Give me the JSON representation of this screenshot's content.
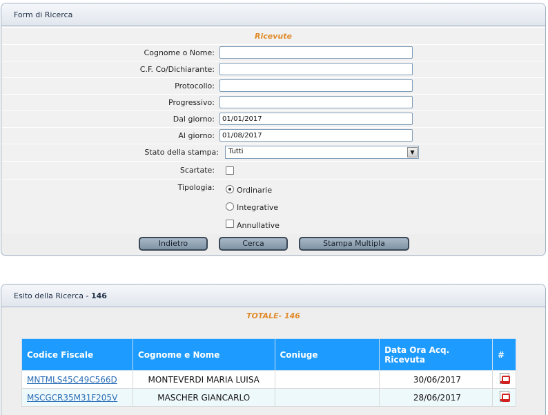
{
  "form_panel": {
    "title": "Form di Ricerca",
    "section_title": "Ricevute",
    "fields": {
      "cognome_label": "Cognome o Nome:",
      "cognome_value": "",
      "cf_label": "C.F. Co/Dichiarante:",
      "cf_value": "",
      "protocollo_label": "Protocollo:",
      "protocollo_value": "",
      "progressivo_label": "Progressivo:",
      "progressivo_value": "",
      "dal_label": "Dal giorno:",
      "dal_value": "01/01/2017",
      "al_label": "Al giorno:",
      "al_value": "01/08/2017",
      "stato_label": "Stato della stampa:",
      "stato_value": "Tutti",
      "scartate_label": "Scartate:",
      "tipologia_label": "Tipologia:",
      "tipologia_options": [
        "Ordinarie",
        "Integrative",
        "Annullative"
      ]
    },
    "buttons": {
      "indietro": "Indietro",
      "cerca": "Cerca",
      "stampa": "Stampa Multipla"
    }
  },
  "results_panel": {
    "title_prefix": "Esito della Ricerca -",
    "count": "146",
    "totale": "TOTALE- 146",
    "columns": [
      "Codice Fiscale",
      "Cognome e Nome",
      "Coniuge",
      "Data Ora Acq. Ricevuta",
      "#"
    ],
    "rows": [
      {
        "cf": "MNTMLS45C49C566D",
        "nome": "MONTEVERDI MARIA LUISA",
        "coniuge": "",
        "data": "30/06/2017"
      },
      {
        "cf": "MSCGCR35M31F205V",
        "nome": "MASCHER GIANCARLO",
        "coniuge": "",
        "data": "28/06/2017"
      }
    ]
  },
  "colors": {
    "header_blue": "#1e9bff",
    "accent_orange": "#e08b2a",
    "link_blue": "#2a6db5"
  }
}
